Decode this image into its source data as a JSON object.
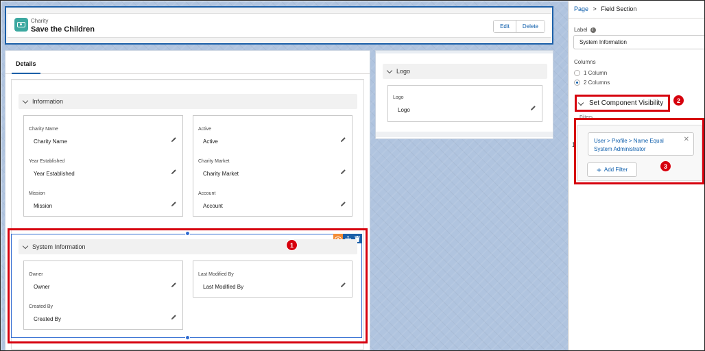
{
  "record": {
    "object_label": "Charity",
    "title": "Save the Children",
    "edit_label": "Edit",
    "delete_label": "Delete"
  },
  "tabs": [
    {
      "label": "Details"
    }
  ],
  "information": {
    "title": "Information",
    "left_fields": [
      {
        "label": "Charity Name",
        "value": "Charity Name"
      },
      {
        "label": "Year Established",
        "value": "Year Established"
      },
      {
        "label": "Mission",
        "value": "Mission"
      }
    ],
    "right_fields": [
      {
        "label": "Active",
        "value": "Active"
      },
      {
        "label": "Charity Market",
        "value": "Charity Market"
      },
      {
        "label": "Account",
        "value": "Account"
      }
    ]
  },
  "system_information": {
    "title": "System Information",
    "left_fields": [
      {
        "label": "Owner",
        "value": "Owner"
      },
      {
        "label": "Created By",
        "value": "Created By"
      }
    ],
    "right_fields": [
      {
        "label": "Last Modified By",
        "value": "Last Modified By"
      }
    ]
  },
  "logo_section": {
    "title": "Logo",
    "field_label": "Logo",
    "field_value": "Logo"
  },
  "panel": {
    "breadcrumb_page": "Page",
    "breadcrumb_sep": ">",
    "breadcrumb_current": "Field Section",
    "label_caption": "Label",
    "label_value": "System Information",
    "columns_caption": "Columns",
    "column_options": [
      {
        "label": "1 Column",
        "selected": false
      },
      {
        "label": "2 Columns",
        "selected": true
      }
    ],
    "visibility_title": "Set Component Visibility",
    "filters_caption": "Filters",
    "filter_index": "1",
    "filter_text": "User > Profile > Name Equal System Administrator",
    "add_filter_label": "Add Filter"
  },
  "callouts": [
    "1",
    "2",
    "3"
  ],
  "colors": {
    "accent": "#1b5fa8",
    "callout": "#d6000d",
    "link": "#0b5cab",
    "record_icon": "#3ba8a0",
    "visibility_tool": "#f38b35"
  }
}
